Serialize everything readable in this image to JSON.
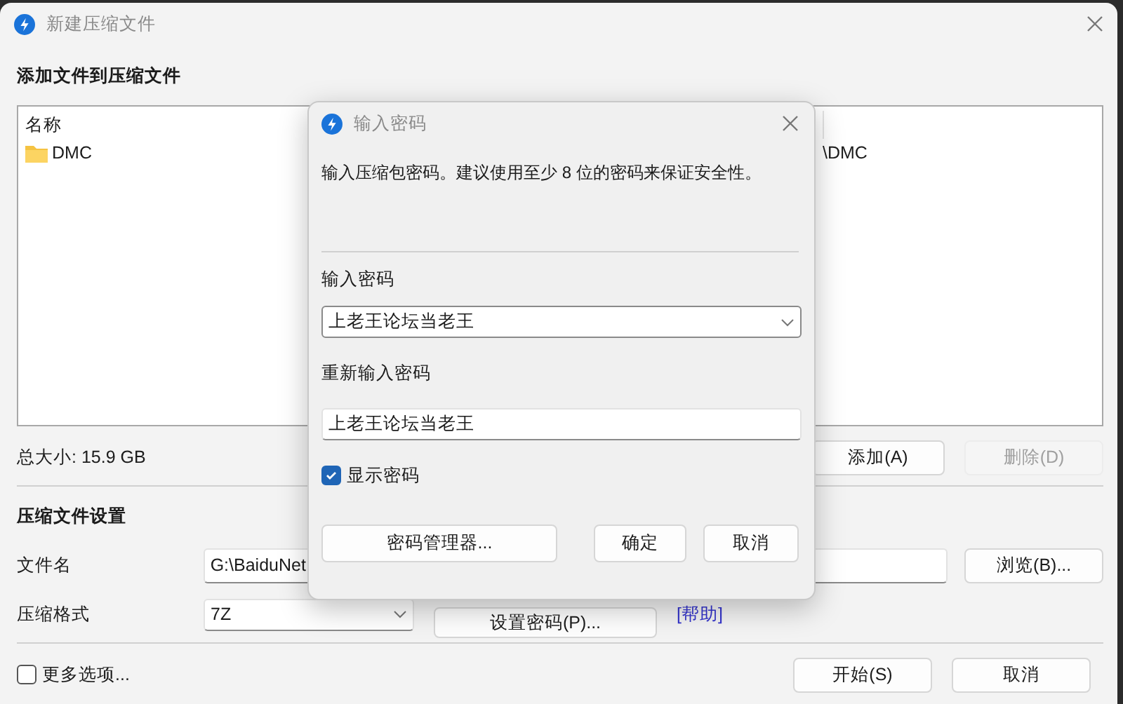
{
  "window": {
    "title": "新建压缩文件"
  },
  "add_section": {
    "heading": "添加文件到压缩文件",
    "columns": [
      "名称"
    ],
    "rows": [
      {
        "name": "DMC",
        "column_2": "\\DMC"
      }
    ],
    "total_size": "总大小: 15.9 GB",
    "buttons": [
      {
        "label": "添加(A)",
        "disabled": false
      },
      {
        "label": "删除(D)",
        "disabled": true
      }
    ]
  },
  "settings": {
    "heading": "压缩文件设置",
    "file_name_label": "文件名",
    "file_name": "G:\\BaiduNet",
    "browse_button": "浏览(B)...",
    "format_label": "压缩格式",
    "format": "7Z",
    "password_button": "设置密码(P)...",
    "help_link": "[帮助]"
  },
  "footer": {
    "more_options": {
      "label": "更多选项...",
      "checked": false
    },
    "buttons": [
      "开始(S)",
      "取消"
    ]
  },
  "dialog": {
    "title": "输入密码",
    "message": "输入压缩包密码。建议使用至少 8 位的密码来保证安全性。",
    "password_label": "输入密码",
    "password": "上老王论坛当老王",
    "reenter_label": "重新输入密码",
    "reenter": "上老王论坛当老王",
    "show_password": {
      "label": "显示密码",
      "checked": true
    },
    "manager_button": "密码管理器...",
    "buttons": [
      "确定",
      "取消"
    ]
  }
}
